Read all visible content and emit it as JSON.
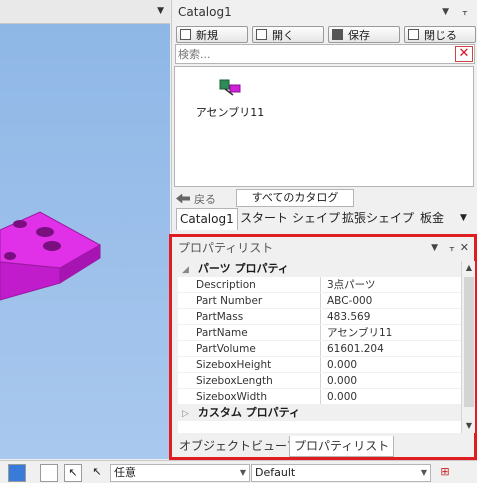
{
  "catalog": {
    "title": "Catalog1",
    "toolbar": [
      {
        "label": "新規",
        "icon": "new-icon"
      },
      {
        "label": "開く",
        "icon": "open-icon"
      },
      {
        "label": "保存",
        "icon": "save-icon"
      },
      {
        "label": "閉じる",
        "icon": "close-doc-icon"
      }
    ],
    "search_placeholder": "検索...",
    "items": [
      {
        "label": "アセンブリ11",
        "icon": "assembly-icon"
      }
    ],
    "back_label": "戻る",
    "all_catalogs_label": "すべてのカタログ",
    "tabs": [
      "Catalog1",
      "スタート",
      "シェイプ",
      "拡張シェイプ",
      "板金"
    ]
  },
  "properties": {
    "title": "プロパティリスト",
    "group1": "パーツ プロパティ",
    "rows": [
      {
        "key": "Description",
        "value": "3点パーツ"
      },
      {
        "key": "Part Number",
        "value": "ABC-000"
      },
      {
        "key": "PartMass",
        "value": "483.569"
      },
      {
        "key": "PartName",
        "value": "アセンブリ11"
      },
      {
        "key": "PartVolume",
        "value": "61601.204"
      },
      {
        "key": "SizeboxHeight",
        "value": "0.000"
      },
      {
        "key": "SizeboxLength",
        "value": "0.000"
      },
      {
        "key": "SizeboxWidth",
        "value": "0.000"
      }
    ],
    "group2": "カスタム プロパティ",
    "tabs": [
      "オブジェクトビューア",
      "プロパティリスト"
    ],
    "highlight_color": "#e01d20"
  },
  "bottombar": {
    "filter_value": "任意",
    "style_value": "Default"
  },
  "colors": {
    "part_color": "#e030e8",
    "viewport_bg": "#9bbde9"
  }
}
